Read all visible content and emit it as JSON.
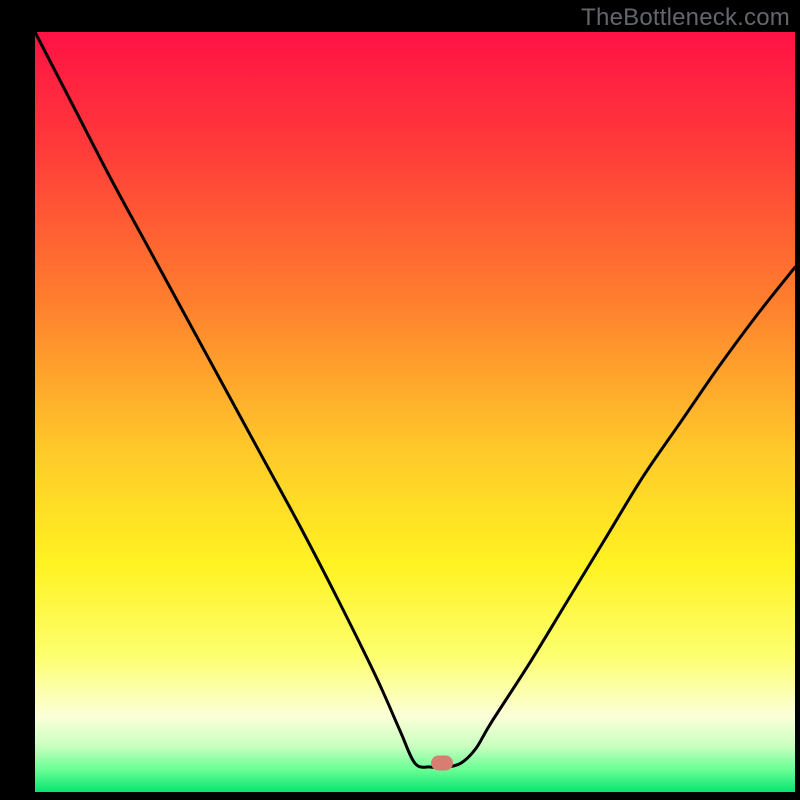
{
  "watermark": "TheBottleneck.com",
  "chart_data": {
    "type": "line",
    "title": "",
    "xlabel": "",
    "ylabel": "",
    "xlim": [
      0,
      100
    ],
    "ylim": [
      0,
      100
    ],
    "gradient_stops": [
      {
        "offset": 0,
        "color": "#ff1245"
      },
      {
        "offset": 15,
        "color": "#ff3a3a"
      },
      {
        "offset": 35,
        "color": "#ff7d2e"
      },
      {
        "offset": 55,
        "color": "#ffc92a"
      },
      {
        "offset": 70,
        "color": "#fff222"
      },
      {
        "offset": 82,
        "color": "#fdff6e"
      },
      {
        "offset": 90,
        "color": "#fcffd8"
      },
      {
        "offset": 94,
        "color": "#c8ffc0"
      },
      {
        "offset": 97,
        "color": "#6bff95"
      },
      {
        "offset": 100,
        "color": "#09e371"
      }
    ],
    "series": [
      {
        "name": "bottleneck-curve",
        "x": [
          0,
          5,
          10,
          15,
          20,
          25,
          30,
          35,
          40,
          45,
          48,
          50,
          52,
          54,
          56,
          58,
          60,
          65,
          70,
          75,
          80,
          85,
          90,
          95,
          100
        ],
        "y": [
          100,
          90,
          80,
          70.5,
          61,
          51.5,
          42,
          32.5,
          22.5,
          12,
          5,
          0.5,
          0,
          0,
          0.5,
          2.5,
          6,
          14,
          22.5,
          31,
          39.5,
          47,
          54.5,
          61.5,
          68
        ]
      }
    ],
    "marker": {
      "x": 53.5,
      "y": 0.5,
      "color": "#d77d72"
    },
    "grid": false,
    "legend": false
  }
}
